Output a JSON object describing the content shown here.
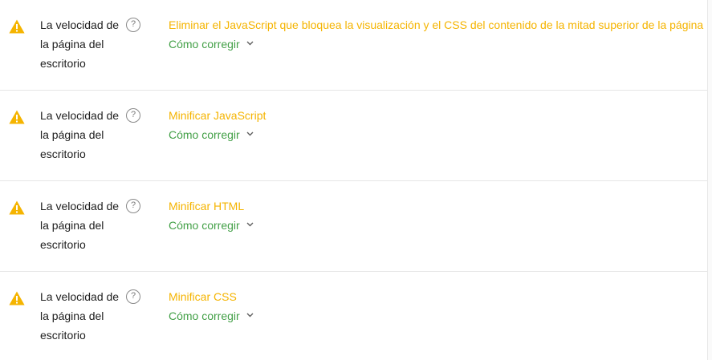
{
  "rows": [
    {
      "category": "La velocidad de la página del escritorio",
      "help_glyph": "?",
      "title": "Eliminar el JavaScript que bloquea la visualización y el CSS del contenido de la mitad superior de la página",
      "fix_label": "Cómo corregir"
    },
    {
      "category": "La velocidad de la página del escritorio",
      "help_glyph": "?",
      "title": "Minificar JavaScript",
      "fix_label": "Cómo corregir"
    },
    {
      "category": "La velocidad de la página del escritorio",
      "help_glyph": "?",
      "title": "Minificar HTML",
      "fix_label": "Cómo corregir"
    },
    {
      "category": "La velocidad de la página del escritorio",
      "help_glyph": "?",
      "title": "Minificar CSS",
      "fix_label": "Cómo corregir"
    }
  ],
  "colors": {
    "warning": "#f5b400",
    "fix_link": "#43a047",
    "text": "#212121"
  },
  "icons": {
    "warning": "warning-triangle-icon",
    "help": "help-circle-icon",
    "expand": "chevron-down-icon"
  }
}
